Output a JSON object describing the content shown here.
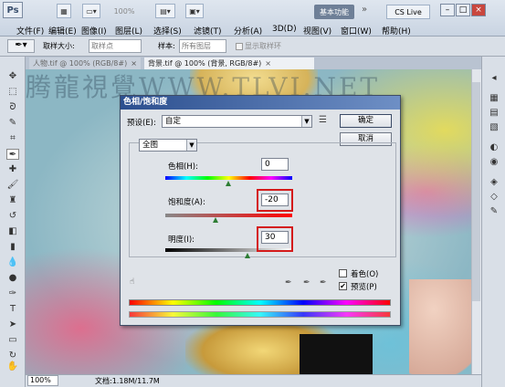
{
  "app": {
    "logo": "Ps",
    "zoom_display": "100%",
    "workspace": "基本功能",
    "cslive": "CS Live"
  },
  "menu": [
    "文件(F)",
    "编辑(E)",
    "图像(I)",
    "图层(L)",
    "选择(S)",
    "滤镜(T)",
    "分析(A)",
    "3D(D)",
    "视图(V)",
    "窗口(W)",
    "帮助(H)"
  ],
  "options": {
    "sample_size_label": "取样大小:",
    "sample_size_value": "取样点",
    "sample_label": "样本:",
    "sample_value": "所有图层",
    "show_ring": "显示取样环"
  },
  "tabs": [
    {
      "label": "人物.tif @ 100% (RGB/8#)",
      "close": "×"
    },
    {
      "label": "背景.tif @ 100% (背景, RGB/8#)",
      "close": "×"
    }
  ],
  "watermark": "腾龍視覺WWW.TLVI.NET",
  "status": {
    "zoom": "100%",
    "doc": "文档:1.18M/11.7M"
  },
  "dialog": {
    "title": "色相/饱和度",
    "preset_label": "预设(E):",
    "preset_value": "自定",
    "channel_value": "全图",
    "hue_label": "色相(H):",
    "hue_value": "0",
    "saturation_label": "饱和度(A):",
    "saturation_value": "-20",
    "lightness_label": "明度(I):",
    "lightness_value": "30",
    "ok_label": "确定",
    "cancel_label": "取消",
    "colorize_label": "着色(O)",
    "preview_label": "预览(P)",
    "preview_checked": "✔"
  }
}
